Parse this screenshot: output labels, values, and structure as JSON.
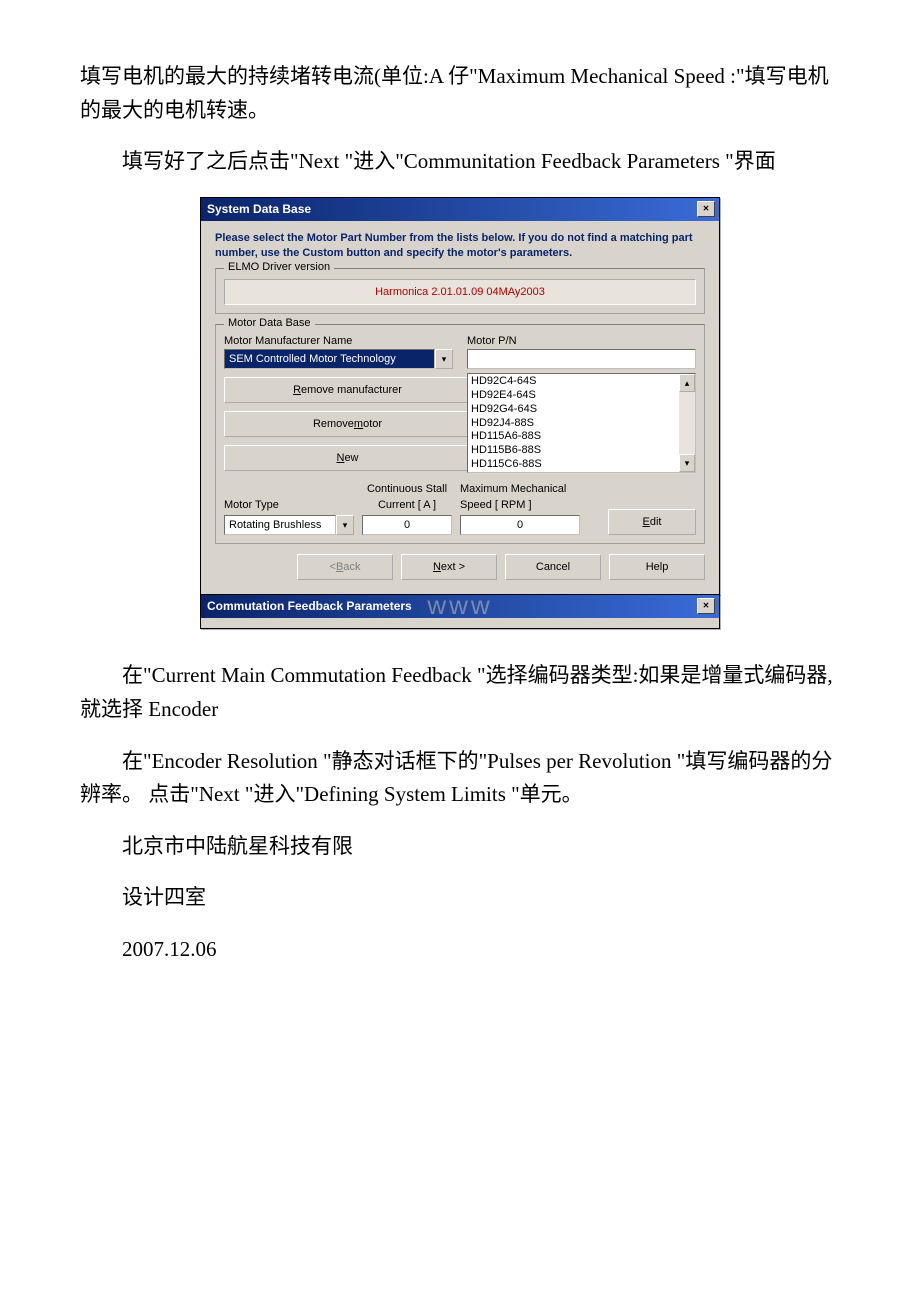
{
  "para1": "填写电机的最大的持续堵转电流(单位:A 仔\"Maximum Mechanical Speed :\"填写电机的最大的电机转速。",
  "para2": "填写好了之后点击\"Next \"进入\"Communitation Feedback Parameters \"界面",
  "para3": "在\"Current Main Commutation Feedback \"选择编码器类型:如果是增量式编码器,就选择 Encoder",
  "para4": "在\"Encoder Resolution \"静态对话框下的\"Pulses per Revolution \"填写编码器的分辨率。 点击\"Next \"进入\"Defining System Limits \"单元。",
  "para5": "北京市中陆航星科技有限",
  "para6": "设计四室",
  "para7": "2007.12.06",
  "dialog1": {
    "title": "System Data Base",
    "instruction": "Please select the Motor Part Number from the lists below. If you do not find a matching part number, use the Custom button and specify the motor's parameters.",
    "driver_group_title": "ELMO Driver version",
    "driver_version": "Harmonica 2.01.01.09 04MAy2003",
    "mdb_group_title": "Motor Data Base",
    "manuf_label": "Motor Manufacturer Name",
    "manuf_value": "SEM Controlled Motor Technology",
    "btn_remove_manuf_pre": "",
    "btn_remove_manuf_u": "R",
    "btn_remove_manuf_post": "emove manufacturer",
    "btn_remove_motor_pre": "Remove ",
    "btn_remove_motor_u": "m",
    "btn_remove_motor_post": "otor",
    "btn_new_u": "N",
    "btn_new_post": "ew",
    "motor_pn_label": "Motor P/N",
    "motor_pn_items": [
      "HD92C4-64S",
      "HD92E4-64S",
      "HD92G4-64S",
      "HD92J4-88S",
      "HD115A6-88S",
      "HD115B6-88S",
      "HD115C6-88S"
    ],
    "motor_type_label": "Motor Type",
    "motor_type_value": "Rotating Brushless",
    "cont_stall_label1": "Continuous Stall",
    "cont_stall_label2": "Current [ A ]",
    "cont_stall_value": "0",
    "max_speed_label1": "Maximum Mechanical",
    "max_speed_label2": "Speed  [ RPM ]",
    "max_speed_value": "0",
    "btn_edit_u": "E",
    "btn_edit_post": "dit",
    "btn_back_pre": "< ",
    "btn_back_u": "B",
    "btn_back_post": "ack",
    "btn_next_u": "N",
    "btn_next_post": "ext >",
    "btn_cancel": "Cancel",
    "btn_help": "Help"
  },
  "dialog2": {
    "title": "Commutation Feedback Parameters"
  },
  "watermark": "www"
}
